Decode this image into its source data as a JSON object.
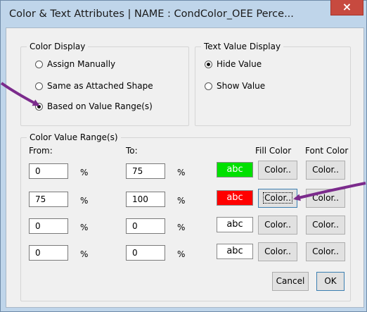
{
  "window": {
    "title": "Color & Text Attributes | NAME : CondColor_OEE Perce...",
    "close_label": "×"
  },
  "color_display": {
    "label": "Color Display",
    "options": [
      {
        "label": "Assign Manually",
        "selected": false
      },
      {
        "label": "Same as Attached Shape",
        "selected": false
      },
      {
        "label": "Based on Value Range(s)",
        "selected": true
      }
    ]
  },
  "text_value_display": {
    "label": "Text Value Display",
    "options": [
      {
        "label": "Hide Value",
        "selected": true
      },
      {
        "label": "Show Value",
        "selected": false
      }
    ]
  },
  "ranges": {
    "label": "Color Value Range(s)",
    "from_header": "From:",
    "to_header": "To:",
    "fill_header": "Fill Color",
    "font_header": "Font Color",
    "percent": "%",
    "rows": [
      {
        "from": "0",
        "to": "75",
        "swatch_text": "abc",
        "fill": "#00e000",
        "text_color": "#ffffff",
        "fill_btn": "Color..",
        "font_btn": "Color.."
      },
      {
        "from": "75",
        "to": "100",
        "swatch_text": "abc",
        "fill": "#ff0000",
        "text_color": "#ffffff",
        "fill_btn": "Color..",
        "font_btn": "Color.."
      },
      {
        "from": "0",
        "to": "0",
        "swatch_text": "abc",
        "fill": "#ffffff",
        "text_color": "#000000",
        "fill_btn": "Color..",
        "font_btn": "Color.."
      },
      {
        "from": "0",
        "to": "0",
        "swatch_text": "abc",
        "fill": "#ffffff",
        "text_color": "#000000",
        "fill_btn": "Color..",
        "font_btn": "Color.."
      }
    ]
  },
  "footer": {
    "cancel_label": "Cancel",
    "ok_label": "OK"
  },
  "annotation_color": "#7b2b8c"
}
